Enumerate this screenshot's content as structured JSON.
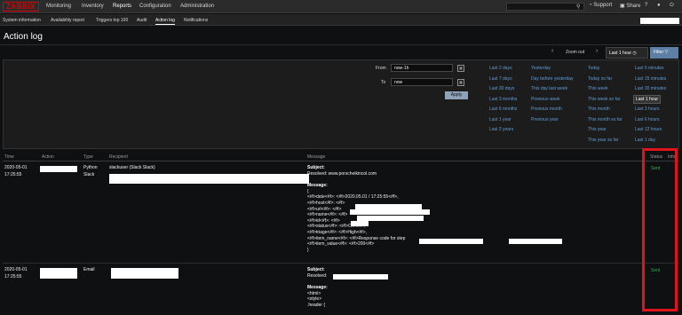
{
  "app": {
    "logo": "ZABBIX",
    "menu": [
      "Monitoring",
      "Inventory",
      "Reports",
      "Configuration",
      "Administration"
    ],
    "active_menu": "Reports",
    "top_icons": [
      "Support",
      "Share",
      "?"
    ]
  },
  "subnav": {
    "items": [
      "System information",
      "Availability report",
      "Triggers top 100",
      "Audit",
      "Action log",
      "Notifications"
    ],
    "active": "Action log"
  },
  "page": {
    "title": "Action log"
  },
  "timebar": {
    "zoom_out": "Zoom out",
    "period": "Last 1 hour",
    "filter": "Filter"
  },
  "filter": {
    "from_label": "From",
    "from_value": "now-1h",
    "to_label": "To",
    "to_value": "now",
    "apply": "Apply",
    "ranges": [
      [
        "Last 2 days",
        "Last 7 days",
        "Last 30 days",
        "Last 3 months",
        "Last 6 months",
        "Last 1 year",
        "Last 2 years"
      ],
      [
        "Yesterday",
        "Day before yesterday",
        "This day last week",
        "Previous week",
        "Previous month",
        "Previous year"
      ],
      [
        "Today",
        "Today so far",
        "This week",
        "This week so far",
        "This month",
        "This month so far",
        "This year",
        "This year so far"
      ],
      [
        "Last 5 minutes",
        "Last 15 minutes",
        "Last 30 minutes",
        "Last 1 hour",
        "Last 3 hours",
        "Last 6 hours",
        "Last 12 hours",
        "Last 1 day"
      ]
    ],
    "selected_range": "Last 1 hour"
  },
  "table": {
    "headers": [
      "Time",
      "Action",
      "Type",
      "Recipient",
      "Message",
      "Status",
      "Info"
    ],
    "rows": [
      {
        "date": "2020-05-01",
        "time": "17:25:55",
        "type_line1": "Python",
        "type_line2": "Slack",
        "recipient": "slackuser (Slack Slack)",
        "subject_label": "Subject:",
        "subject": "Resolved: www.porscheikincol.com",
        "message_label": "Message:",
        "message_lines": [
          "{",
          "<#f>date<#f>: <#f>2020.05.01 / 17:25:55<#f>,",
          "<#f>host<#f>: <#f>",
          "<#f>url<#f>: <#f>",
          "<#f>name<#f>: <#f>",
          "<#f>id<#f>: <#f>",
          "<#f>status<#f>: <#f>OK<#f>,",
          "<#f>triage<#f>: <#f>High<#f>,",
          "<#f>item_name<#f>: <#f>Response code for step",
          "<#f>item_value<#f>: <#f>200<#f>",
          "}"
        ],
        "status": "Sent"
      },
      {
        "date": "2020-05-01",
        "time": "17:25:55",
        "type_line1": "Email",
        "subject_label": "Subject:",
        "subject": "Resolved:",
        "message_label": "Message:",
        "message_lines": [
          "<html>",
          "<style>",
          ".header {"
        ],
        "status": "Sent"
      }
    ]
  },
  "colors": {
    "background": "#0e1012",
    "link": "#5f9dd6",
    "sent": "#29b34f",
    "highlight": "#e0141a",
    "logo": "#d40000"
  }
}
